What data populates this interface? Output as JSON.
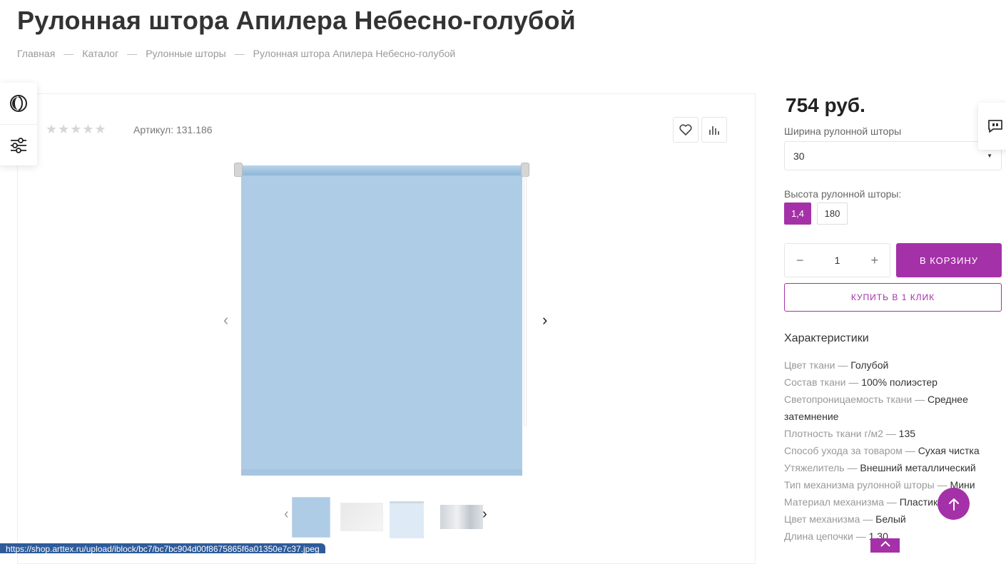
{
  "page": {
    "title": "Рулонная штора Апилера Небесно-голубой"
  },
  "breadcrumb": {
    "items": [
      "Главная",
      "Каталог",
      "Рулонные шторы",
      "Рулонная штора Апилера Небесно-голубой"
    ],
    "separator": "—"
  },
  "side_panel": {
    "icons": [
      "contrast-icon",
      "filter-sliders-icon"
    ]
  },
  "product": {
    "rating_stars": "★★★★★",
    "rating_value": 0,
    "article_label": "Артикул: 131.186",
    "price": "754 руб."
  },
  "gallery": {
    "prev_icon": "‹",
    "next_icon": "›",
    "thumb_prev": "‹",
    "thumb_next": "›",
    "thumbnails_count": 4
  },
  "options": {
    "width_label": "Ширина рулонной шторы",
    "width_value": "30",
    "height_label": "Высота рулонной шторы:",
    "height_options": [
      "1,4",
      "180"
    ],
    "height_selected": "1,4"
  },
  "purchase": {
    "qty_minus": "−",
    "qty_value": "1",
    "qty_plus": "+",
    "cart_label": "В КОРЗИНУ",
    "oneclick_label": "КУПИТЬ В 1 КЛИК"
  },
  "specs": {
    "title": "Характеристики",
    "dash": "—",
    "rows": [
      {
        "k": "Цвет ткани",
        "v": "Голубой"
      },
      {
        "k": "Состав ткани",
        "v": "100% полиэстер"
      },
      {
        "k": "Светопроницаемость ткани",
        "v": "Среднее затемнение"
      },
      {
        "k": "Плотность ткани г/м2",
        "v": "135"
      },
      {
        "k": "Способ ухода за товаром",
        "v": "Сухая чистка"
      },
      {
        "k": "Утяжелитель",
        "v": "Внешний металлический"
      },
      {
        "k": "Тип механизма рулонной шторы",
        "v": "Мини"
      },
      {
        "k": "Материал механизма",
        "v": "Пластик"
      },
      {
        "k": "Цвет механизма",
        "v": "Белый"
      },
      {
        "k": "Длина цепочки",
        "v": "1,30"
      }
    ]
  },
  "status_bar": {
    "url": "https://shop.arttex.ru/upload/iblock/bc7/bc7bc904d00f8675865f6a01350e7c37.jpeg"
  },
  "colors": {
    "accent": "#a531a8",
    "fabric": "#aecce6"
  }
}
